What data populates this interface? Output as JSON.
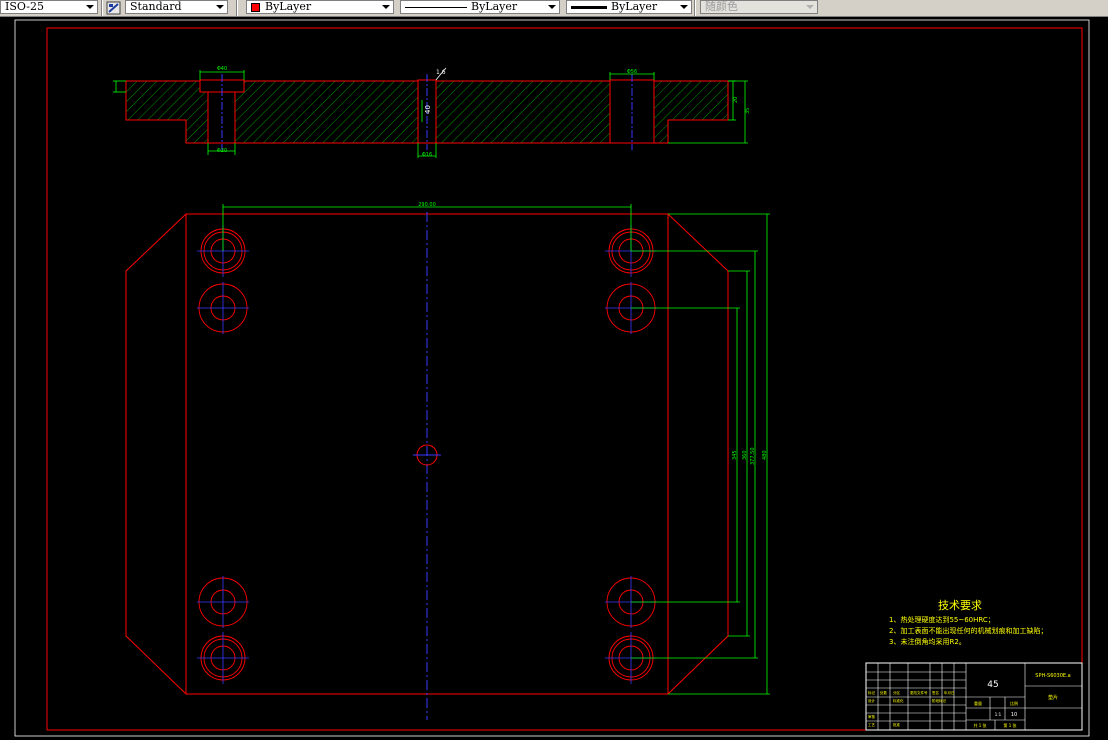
{
  "toolbar": {
    "dimstyle": "ISO-25",
    "textstyle": "Standard",
    "layer_color": "ByLayer",
    "linetype": "ByLayer",
    "lineweight": "ByLayer",
    "plotstyle": "随颜色",
    "colors": {
      "toolbar_bg": "#d4d0c8",
      "color_swatch": "#ff0000"
    }
  },
  "drawing": {
    "colors": {
      "background": "#000000",
      "outline": "#ff0000",
      "dimension": "#00ff00",
      "centerline": "#0000ff",
      "hatch": "#00ff00",
      "text": "#ffff00",
      "table_text": "#ffffff"
    },
    "section_view": {
      "dims": {
        "top_left": "Φ40",
        "bottom_left": "Φ20",
        "center_height": "40",
        "center_bottom": "Φ16",
        "top_right": "Φ56",
        "right_1": "20",
        "right_2": "35",
        "roughness": "1.6"
      }
    },
    "plan_view": {
      "dims": {
        "top_width": "290.00",
        "v1": "345",
        "v2": "360",
        "v3": "377.50",
        "v4": "480"
      }
    },
    "tech_requirements": {
      "title": "技术要求",
      "items": [
        "1、热处理硬度达到55~60HRC；",
        "2、加工表面不能出现任何的机械划痕和加工缺陷；",
        "3、未注倒角均采用R2。"
      ]
    },
    "title_block": {
      "material": "45",
      "drawing_name": "垫片",
      "part_code": "SPH-S6030E.a",
      "scale_label": "比例",
      "scale_value": "1:1",
      "sheet_label": "共 1 张",
      "sheet_no": "第 1 张",
      "weight_label": "重量",
      "small_value": "10",
      "cells": [
        "标记",
        "处数",
        "分区",
        "更改文件号",
        "签名",
        "年月日",
        "设计",
        "标准化",
        "阶段标记",
        "审核",
        "工艺",
        "批准"
      ]
    }
  }
}
